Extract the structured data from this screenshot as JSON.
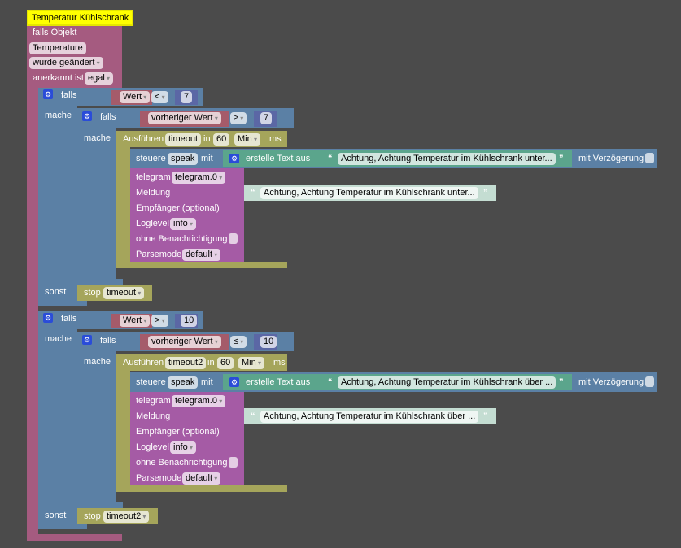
{
  "event": {
    "title": "Temperatur Kühlschrank",
    "falls_objekt": "falls Objekt",
    "object": "Temperature",
    "trigger": "wurde geändert",
    "ack_label": "anerkannt ist",
    "ack_value": "egal"
  },
  "labels": {
    "falls": "falls",
    "mache": "mache",
    "sonst": "sonst",
    "ausfuehren": "Ausführen",
    "in": "in",
    "ms": "ms",
    "steuere": "steuere",
    "mit": "mit",
    "erstelle": "erstelle Text aus",
    "mit_verz": "mit Verzögerung",
    "telegram": "telegram",
    "meldung": "Meldung",
    "empfaenger": "Empfänger (optional)",
    "loglevel": "Loglevel",
    "ohne": "ohne Benachrichtigung",
    "parsemode": "Parsemode",
    "stop": "stop",
    "quote_open": "“",
    "quote_close": "”"
  },
  "groups": [
    {
      "var": "Wert",
      "op": "<",
      "num": "7",
      "prev_var": "vorheriger Wert",
      "prev_op": "≥",
      "prev_num": "7",
      "timer": "timeout",
      "delay": "60",
      "unit": "Min",
      "state": "speak",
      "text": "Achtung, Achtung Temperatur im Kühlschrank unter...",
      "telegram": "telegram.0",
      "meldung": "Achtung, Achtung Temperatur im Kühlschrank unter...",
      "loglevel": "info",
      "parsemode": "default",
      "stop_timer": "timeout"
    },
    {
      "var": "Wert",
      "op": ">",
      "num": "10",
      "prev_var": "vorheriger Wert",
      "prev_op": "≤",
      "prev_num": "10",
      "timer": "timeout2",
      "delay": "60",
      "unit": "Min",
      "state": "speak",
      "text": "Achtung, Achtung Temperatur im Kühlschrank über ...",
      "telegram": "telegram.0",
      "meldung": "Achtung, Achtung Temperatur im Kühlschrank über ...",
      "loglevel": "info",
      "parsemode": "default",
      "stop_timer": "timeout2"
    }
  ]
}
